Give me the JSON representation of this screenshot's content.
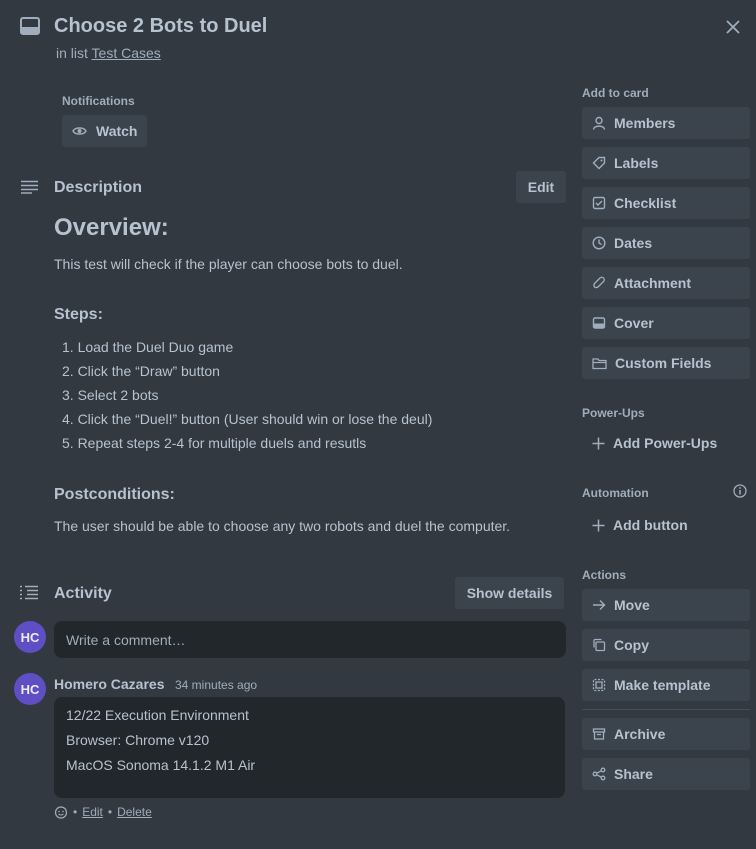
{
  "card": {
    "title": "Choose 2 Bots to Duel",
    "in_list_prefix": "in list",
    "list_name": "Test Cases"
  },
  "notifications": {
    "label": "Notifications",
    "watch_label": "Watch"
  },
  "description": {
    "heading": "Description",
    "edit_label": "Edit",
    "overview_title": "Overview:",
    "overview_text": "This test will check if the player can choose bots to duel.",
    "steps_title": "Steps:",
    "steps": [
      "1.  Load the Duel Duo game",
      "2.  Click the “Draw” button",
      "3.  Select 2 bots",
      "4.  Click the “Duel!” button (User should win or lose the deul)",
      "5.  Repeat steps 2-4 for multiple duels and resutls"
    ],
    "postconditions_title": "Postconditions:",
    "postconditions_text": "The user should be able to choose any two robots and duel the computer."
  },
  "activity": {
    "heading": "Activity",
    "show_details_label": "Show details",
    "avatar_initials": "HC",
    "comment_placeholder": "Write a comment…",
    "comments": [
      {
        "initials": "HC",
        "author": "Homero Cazares",
        "time": "34 minutes ago",
        "lines": [
          "12/22 Execution Environment",
          "Browser: Chrome v120",
          "MacOS Sonoma 14.1.2 M1 Air"
        ],
        "edit_label": "Edit",
        "delete_label": "Delete",
        "separator": "•"
      }
    ]
  },
  "sidebar": {
    "add_to_card_label": "Add to card",
    "add_to_card": [
      {
        "label": "Members",
        "icon": "person-icon"
      },
      {
        "label": "Labels",
        "icon": "tag-icon"
      },
      {
        "label": "Checklist",
        "icon": "checkbox-icon"
      },
      {
        "label": "Dates",
        "icon": "clock-icon"
      },
      {
        "label": "Attachment",
        "icon": "paperclip-icon"
      },
      {
        "label": "Cover",
        "icon": "card-cover-icon"
      },
      {
        "label": "Custom Fields",
        "icon": "fields-icon"
      }
    ],
    "powerups_label": "Power-Ups",
    "add_powerups_label": "Add Power-Ups",
    "automation_label": "Automation",
    "add_button_label": "Add button",
    "actions_label": "Actions",
    "actions": [
      {
        "label": "Move",
        "icon": "arrow-right-icon"
      },
      {
        "label": "Copy",
        "icon": "copy-icon"
      },
      {
        "label": "Make template",
        "icon": "template-icon"
      },
      {
        "label": "Archive",
        "icon": "archive-icon"
      },
      {
        "label": "Share",
        "icon": "share-icon"
      }
    ]
  },
  "colors": {
    "background": "#323940",
    "button": "#3b444c",
    "input": "#22272b",
    "text": "#b6c2cf",
    "muted": "#9fadbc",
    "avatar": "#5f4ec4"
  }
}
